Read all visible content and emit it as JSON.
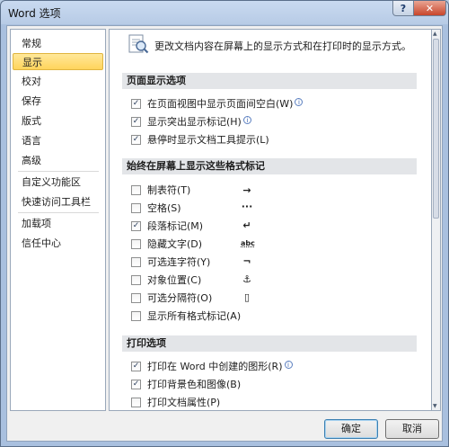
{
  "window": {
    "title": "Word 选项",
    "help_label": "?",
    "close_label": "✕"
  },
  "sidebar": {
    "items": [
      {
        "label": "常规"
      },
      {
        "label": "显示",
        "selected": true
      },
      {
        "label": "校对"
      },
      {
        "label": "保存"
      },
      {
        "label": "版式"
      },
      {
        "label": "语言"
      },
      {
        "label": "高级"
      },
      {
        "label": "自定义功能区"
      },
      {
        "label": "快速访问工具栏"
      },
      {
        "label": "加载项"
      },
      {
        "label": "信任中心"
      }
    ]
  },
  "content": {
    "intro": "更改文档内容在屏幕上的显示方式和在打印时的显示方式。",
    "sections": [
      {
        "title": "页面显示选项",
        "options": [
          {
            "label": "在页面视图中显示页面间空白(W)",
            "checked": true,
            "info": true
          },
          {
            "label": "显示突出显示标记(H)",
            "checked": true,
            "info": true
          },
          {
            "label": "悬停时显示文档工具提示(L)",
            "checked": true,
            "info": false
          }
        ]
      },
      {
        "title": "始终在屏幕上显示这些格式标记",
        "options": [
          {
            "label": "制表符(T)",
            "checked": false,
            "mark": "→"
          },
          {
            "label": "空格(S)",
            "checked": false,
            "mark": "···"
          },
          {
            "label": "段落标记(M)",
            "checked": true,
            "mark": "↵"
          },
          {
            "label": "隐藏文字(D)",
            "checked": false,
            "mark": "abc"
          },
          {
            "label": "可选连字符(Y)",
            "checked": false,
            "mark": "¬"
          },
          {
            "label": "对象位置(C)",
            "checked": false,
            "mark": "⚓"
          },
          {
            "label": "可选分隔符(O)",
            "checked": false,
            "mark": "▯"
          },
          {
            "label": "显示所有格式标记(A)",
            "checked": false,
            "mark": ""
          }
        ]
      },
      {
        "title": "打印选项",
        "options": [
          {
            "label": "打印在 Word 中创建的图形(R)",
            "checked": true,
            "info": true
          },
          {
            "label": "打印背景色和图像(B)",
            "checked": true,
            "info": false
          },
          {
            "label": "打印文档属性(P)",
            "checked": false,
            "info": false
          }
        ]
      }
    ]
  },
  "footer": {
    "ok_label": "确定",
    "cancel_label": "取消"
  },
  "colors": {
    "selected_bg": "#ffd45c",
    "section_bg": "#e3e5e8",
    "title_bar": "#b7cbe6"
  }
}
